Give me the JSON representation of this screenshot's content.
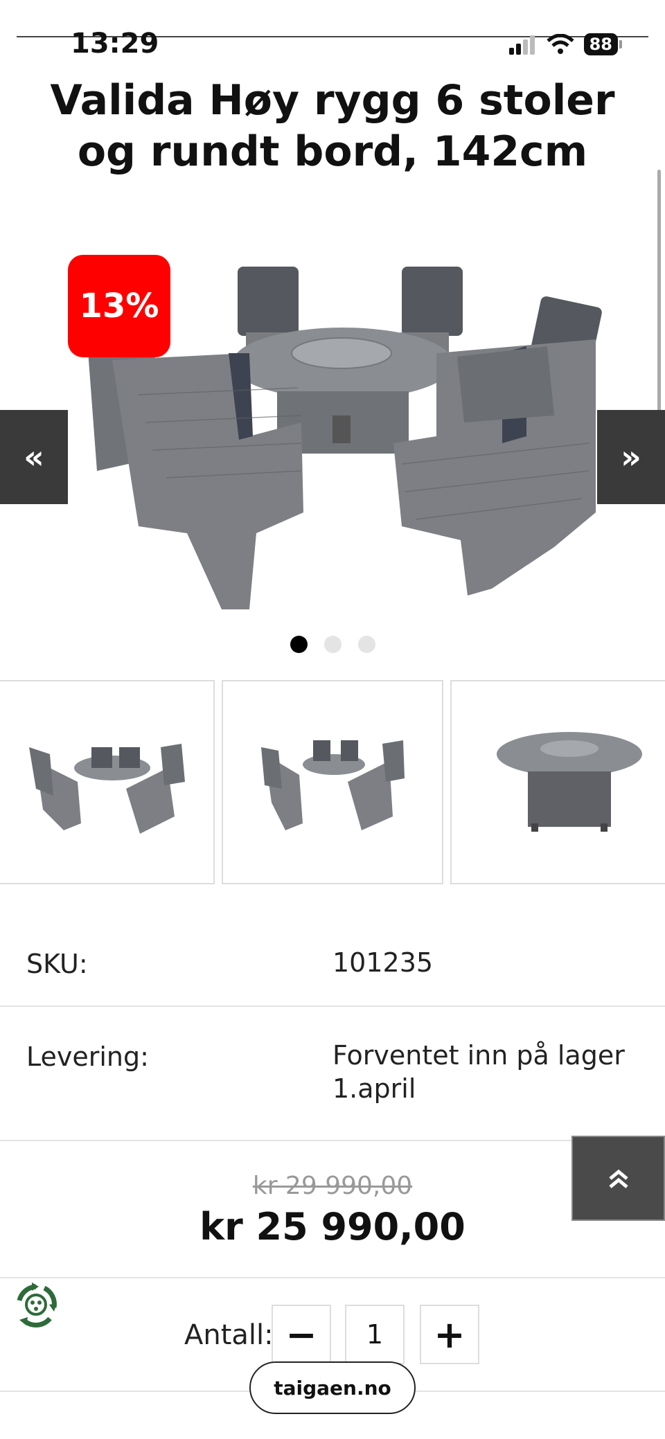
{
  "status_bar": {
    "time": "13:29",
    "battery": "88"
  },
  "product": {
    "title": "Valida Høy rygg 6 stoler og rundt bord, 142cm",
    "discount_badge": "13%",
    "gallery": {
      "prev_arrow": "«",
      "next_arrow": "»",
      "slide_count": 3,
      "active_slide": 1
    },
    "thumbnails": [
      {
        "name": "6 chairs and round table"
      },
      {
        "name": "6 chairs and round table, alternate view"
      },
      {
        "name": "Round table"
      }
    ],
    "specs": [
      {
        "label": "SKU:",
        "value": "101235"
      },
      {
        "label": "Levering:",
        "value": "Forventet inn på lager 1.april"
      }
    ],
    "price": {
      "old": "kr 29 990,00",
      "new": "kr 25 990,00"
    },
    "quantity": {
      "label": "Antall:",
      "value": "1",
      "minus": "−",
      "plus": "+"
    }
  },
  "back_to_top": "⌃",
  "browser": {
    "url": "taigaen.no"
  },
  "colors": {
    "badge": "#ff0000",
    "nav_arrow_bg": "#3a3a3a",
    "active_dot": "#000000"
  }
}
